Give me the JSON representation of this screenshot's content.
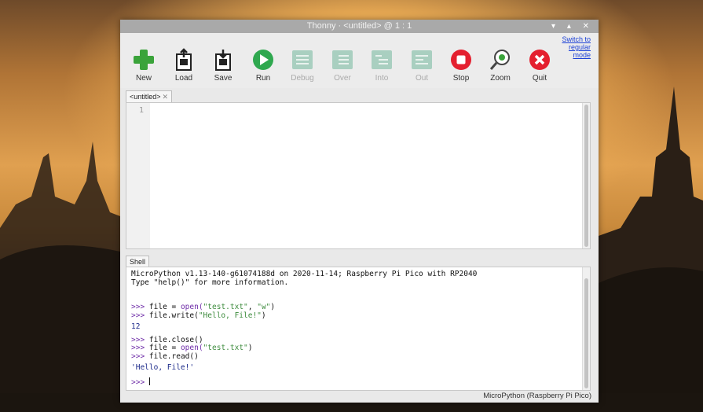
{
  "window": {
    "title": "Thonny  ·  <untitled>  @  1 : 1",
    "controls": "▾ ▴ ✕"
  },
  "toolbar": {
    "buttons": [
      {
        "label": "New",
        "icon": "new-file-icon",
        "enabled": true
      },
      {
        "label": "Load",
        "icon": "load-icon",
        "enabled": true
      },
      {
        "label": "Save",
        "icon": "save-icon",
        "enabled": true
      },
      {
        "label": "Run",
        "icon": "run-icon",
        "enabled": true
      },
      {
        "label": "Debug",
        "icon": "debug-icon",
        "enabled": false
      },
      {
        "label": "Over",
        "icon": "step-over-icon",
        "enabled": false
      },
      {
        "label": "Into",
        "icon": "step-into-icon",
        "enabled": false
      },
      {
        "label": "Out",
        "icon": "step-out-icon",
        "enabled": false
      },
      {
        "label": "Stop",
        "icon": "stop-icon",
        "enabled": true
      },
      {
        "label": "Zoom",
        "icon": "zoom-icon",
        "enabled": true
      },
      {
        "label": "Quit",
        "icon": "quit-icon",
        "enabled": true
      }
    ],
    "switch_mode": {
      "line1": "Switch to",
      "line2": "regular",
      "line3": "mode"
    }
  },
  "editor": {
    "tab_label": "<untitled>",
    "tab_close": "✕",
    "line_numbers": [
      "1"
    ]
  },
  "shell": {
    "tab_label": "Shell",
    "banner": [
      "MicroPython v1.13-140-g61074188d on 2020-11-14; Raspberry Pi Pico with RP2040",
      "Type \"help()\" for more information."
    ],
    "prompt": ">>>",
    "cmd1_pre": "file = ",
    "cmd1_fn": "open(",
    "cmd1_s1": "\"test.txt\"",
    "cmd1_mid": ", ",
    "cmd1_s2": "\"w\"",
    "cmd1_end": ")",
    "cmd2_pre": "file.write(",
    "cmd2_s": "\"Hello, File!\"",
    "cmd2_end": ")",
    "out1": "12",
    "cmd3": "file.close()",
    "cmd4_pre": "file = ",
    "cmd4_fn": "open(",
    "cmd4_s": "\"test.txt\"",
    "cmd4_end": ")",
    "cmd5": "file.read()",
    "out2": "'Hello, File!'"
  },
  "status": {
    "interpreter": "MicroPython (Raspberry Pi Pico)"
  },
  "colors": {
    "accent_green": "#3aa33a",
    "stop_red": "#e4202f",
    "link_blue": "#1a3fd6"
  }
}
